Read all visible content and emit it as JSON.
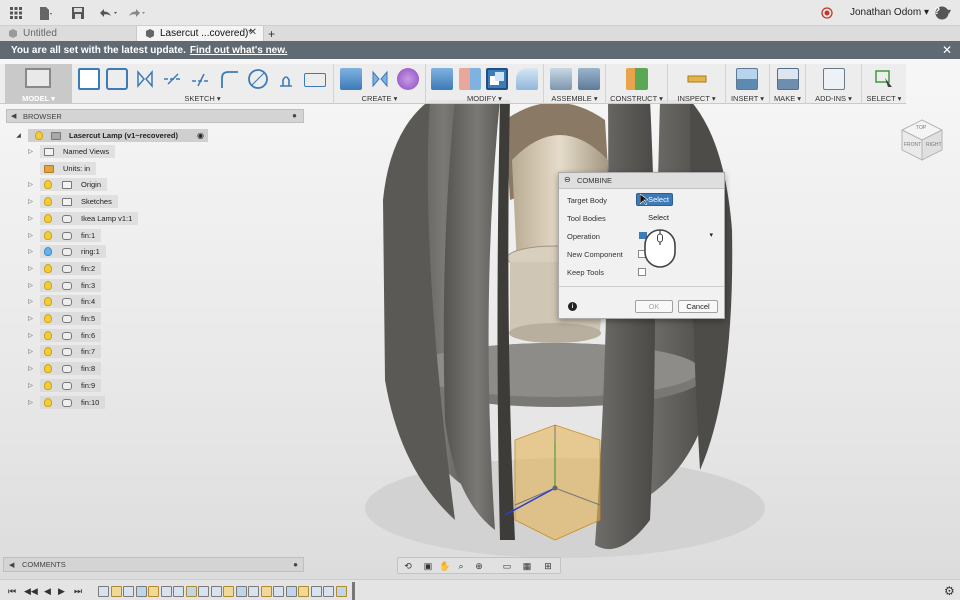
{
  "app": {
    "user": "Jonathan Odom",
    "help_label": "?"
  },
  "tabs": [
    {
      "label": "Untitled"
    },
    {
      "label": "Lasercut ...covered)*"
    }
  ],
  "banner": {
    "text": "You are all set with the latest update.",
    "link": "Find out what's new."
  },
  "ribbon": {
    "groups": [
      {
        "label": "MODEL ▾"
      },
      {
        "label": "SKETCH ▾"
      },
      {
        "label": "CREATE ▾"
      },
      {
        "label": "MODIFY ▾"
      },
      {
        "label": "ASSEMBLE ▾"
      },
      {
        "label": "CONSTRUCT ▾"
      },
      {
        "label": "INSPECT ▾"
      },
      {
        "label": "INSERT ▾"
      },
      {
        "label": "MAKE ▾"
      },
      {
        "label": "ADD-INS ▾"
      },
      {
        "label": "SELECT ▾"
      }
    ]
  },
  "browser": {
    "title": "BROWSER",
    "root": "Lasercut Lamp (v1~recovered)",
    "items": [
      {
        "label": "Named Views"
      },
      {
        "label": "Units: in"
      },
      {
        "label": "Origin"
      },
      {
        "label": "Sketches"
      },
      {
        "label": "Ikea Lamp v1:1"
      },
      {
        "label": "fin:1"
      },
      {
        "label": "ring:1"
      },
      {
        "label": "fin:2"
      },
      {
        "label": "fin:3"
      },
      {
        "label": "fin:4"
      },
      {
        "label": "fin:5"
      },
      {
        "label": "fin:6"
      },
      {
        "label": "fin:7"
      },
      {
        "label": "fin:8"
      },
      {
        "label": "fin:9"
      },
      {
        "label": "fin:10"
      }
    ]
  },
  "comments": {
    "title": "COMMENTS"
  },
  "dialog": {
    "title": "COMBINE",
    "target_body_label": "Target Body",
    "target_body_value": "Select",
    "tool_bodies_label": "Tool Bodies",
    "tool_bodies_value": "Select",
    "operation_label": "Operation",
    "new_component_label": "New Component",
    "keep_tools_label": "Keep Tools",
    "ok_label": "OK",
    "cancel_label": "Cancel"
  },
  "viewcube": {
    "top": "TOP",
    "front": "FRONT",
    "right": "RIGHT"
  },
  "colors": {
    "accent": "#3d7ab8",
    "banner": "#5f6a73",
    "fin": "#6c6a66",
    "highlight": "#e8b24a"
  }
}
